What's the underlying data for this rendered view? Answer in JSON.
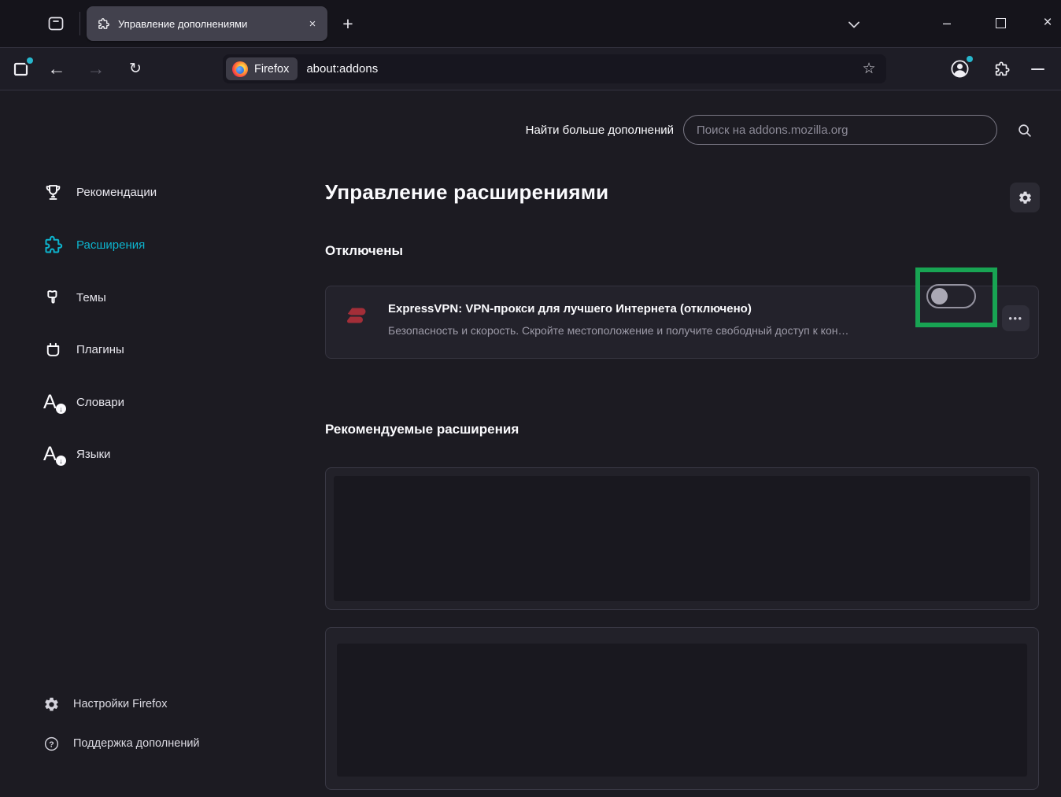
{
  "colors": {
    "accent_teal": "#0db4ce",
    "annotation_green": "#18a453",
    "expressvpn_red": "#a32e38",
    "page_background": "#1c1b22"
  },
  "window": {
    "tab_title": "Управление дополнениями"
  },
  "icons": {
    "back": "←",
    "forward": "→",
    "reload": "↻",
    "new_tab": "+",
    "tab_close": "×",
    "minimize": "–",
    "window_close": "×",
    "star": "☆",
    "meatball": "•••",
    "letter_a": "A",
    "down_arrow": "↓",
    "help_mark": "?"
  },
  "toolbar": {
    "identity_chip": "Firefox",
    "url": "about:addons"
  },
  "search": {
    "label": "Найти больше дополнений",
    "placeholder": "Поиск на addons.mozilla.org",
    "value": ""
  },
  "sidebar": {
    "items": [
      {
        "label": "Рекомендации",
        "icon": "trophy",
        "selected": false
      },
      {
        "label": "Расширения",
        "icon": "puzzle",
        "selected": true
      },
      {
        "label": "Темы",
        "icon": "paintbrush",
        "selected": false
      },
      {
        "label": "Плагины",
        "icon": "plug",
        "selected": false
      },
      {
        "label": "Словари",
        "icon": "letter-a-download",
        "selected": false
      },
      {
        "label": "Языки",
        "icon": "letter-a-download",
        "selected": false
      }
    ],
    "footer": [
      {
        "label": "Настройки Firefox",
        "icon": "gear"
      },
      {
        "label": "Поддержка дополнений",
        "icon": "help"
      }
    ]
  },
  "main": {
    "title": "Управление расширениями",
    "disabled_heading": "Отключены",
    "recommended_heading": "Рекомендуемые расширения",
    "extension": {
      "name": "ExpressVPN: VPN-прокси для лучшего Интернета (отключено)",
      "description": "Безопасность и скорость. Скройте местоположение и получите свободный доступ к кон…",
      "enabled": false
    },
    "recommended_cards_empty": 2
  },
  "annotation": {
    "shape": "rectangle",
    "color": "#18a453",
    "target": "extension-enable-toggle"
  }
}
